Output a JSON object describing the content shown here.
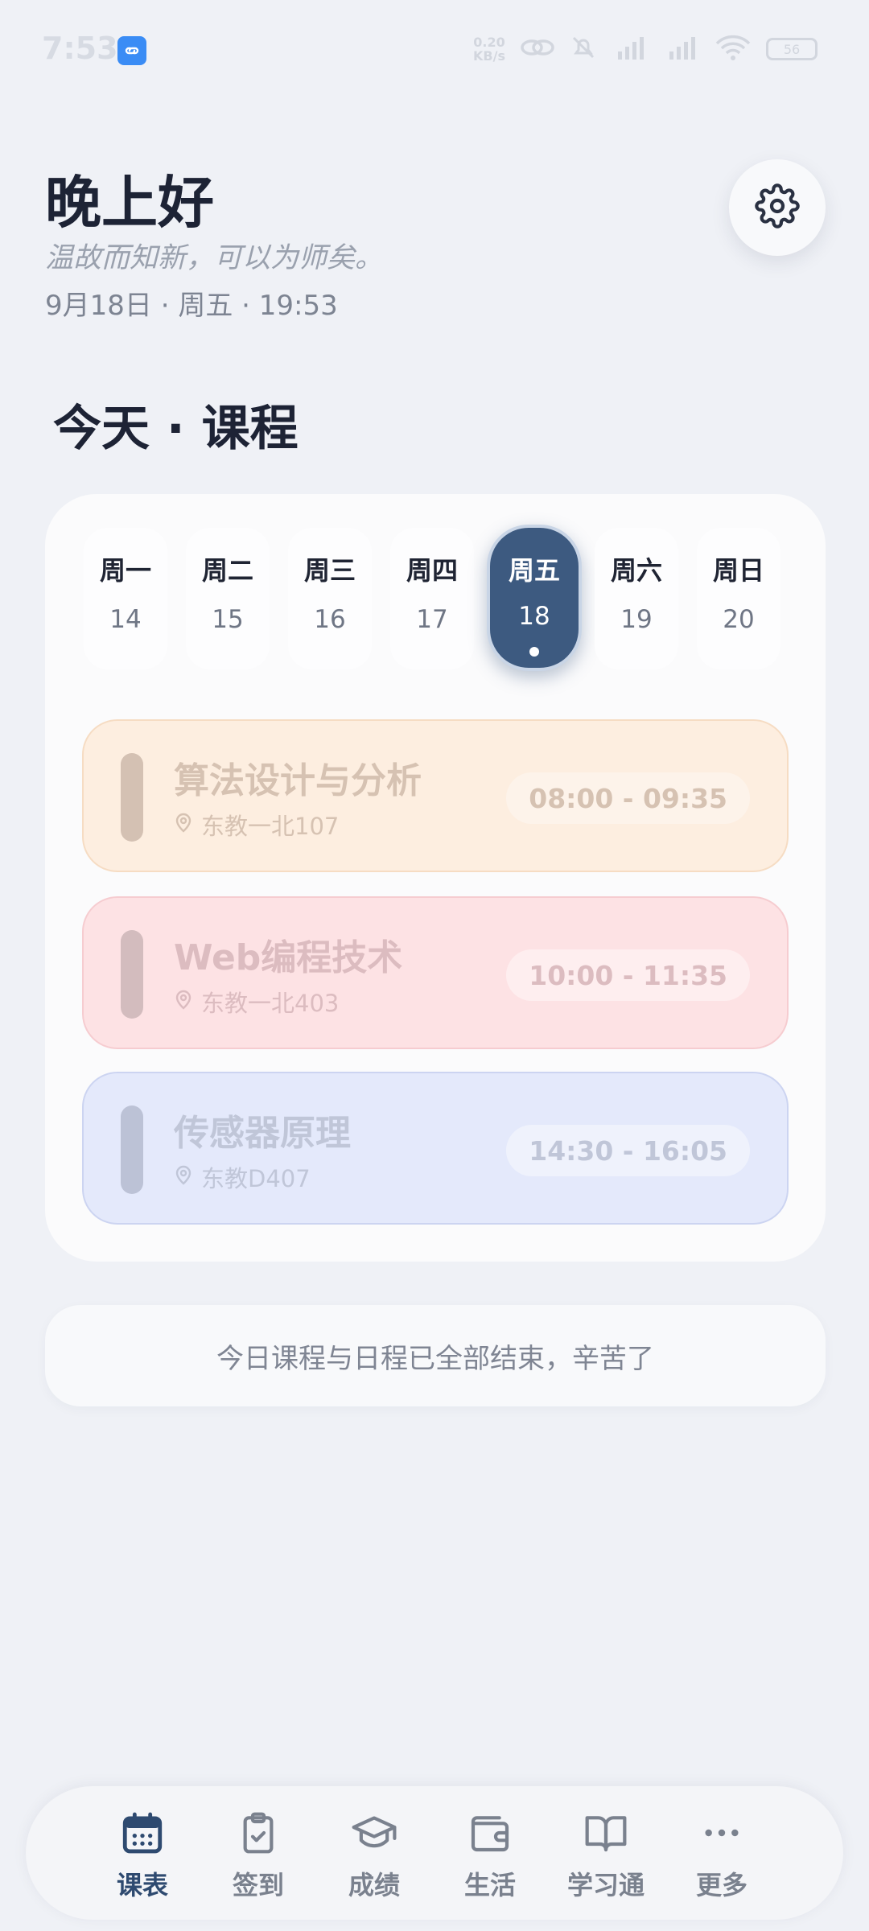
{
  "status_bar": {
    "time": "7:53",
    "net_speed_value": "0.20",
    "net_speed_unit": "KB/s",
    "battery": "56",
    "icons": [
      "link-icon",
      "mute-icon",
      "signal-hd-icon",
      "signal-hd-icon",
      "wifi-icon",
      "battery-icon"
    ]
  },
  "header": {
    "greeting": "晚上好",
    "subtitle": "温故而知新，可以为师矣。",
    "date_line": "9月18日 · 周五 · 19:53",
    "settings_icon": "gear-icon"
  },
  "section_title": "今天 · 课程",
  "week": [
    {
      "name": "周一",
      "num": "14"
    },
    {
      "name": "周二",
      "num": "15"
    },
    {
      "name": "周三",
      "num": "16"
    },
    {
      "name": "周四",
      "num": "17"
    },
    {
      "name": "周五",
      "num": "18",
      "active": true
    },
    {
      "name": "周六",
      "num": "19"
    },
    {
      "name": "周日",
      "num": "20"
    }
  ],
  "courses": [
    {
      "name": "算法设计与分析",
      "location": "东教一北107",
      "time": "08:00 - 09:35"
    },
    {
      "name": "Web编程技术",
      "location": "东教一北403",
      "time": "10:00 - 11:35"
    },
    {
      "name": "传感器原理",
      "location": "东教D407",
      "time": "14:30 - 16:05"
    }
  ],
  "done_message": "今日课程与日程已全部结束，辛苦了",
  "nav": [
    {
      "label": "课表",
      "icon": "calendar-icon",
      "active": true
    },
    {
      "label": "签到",
      "icon": "clipboard-check-icon"
    },
    {
      "label": "成绩",
      "icon": "graduation-cap-icon"
    },
    {
      "label": "生活",
      "icon": "wallet-icon"
    },
    {
      "label": "学习通",
      "icon": "book-icon"
    },
    {
      "label": "更多",
      "icon": "more-icon"
    }
  ],
  "colors": {
    "accent": "#3d5a80",
    "background": "#eff1f6"
  }
}
